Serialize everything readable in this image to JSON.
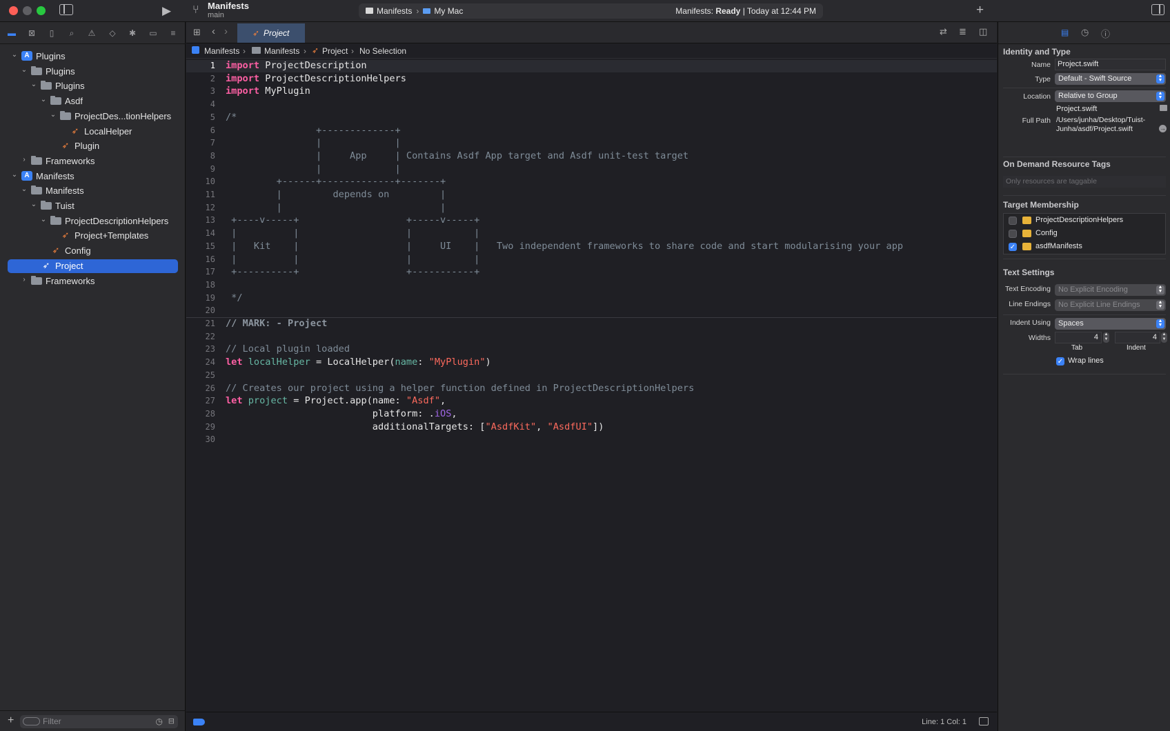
{
  "titlebar": {
    "scheme_name": "Manifests",
    "branch": "main",
    "destination_scheme": "Manifests",
    "destination_device": "My Mac",
    "status_prefix": "Manifests: ",
    "status_state": "Ready",
    "status_time": " | Today at 12:44 PM",
    "icons": [
      "sidebar-toggle-icon",
      "run-icon",
      "branch-icon",
      "add-icon",
      "inspector-toggle-icon"
    ]
  },
  "navigator": {
    "tabs": [
      "folder-icon",
      "source-control-icon",
      "bookmark-icon",
      "find-icon",
      "issue-icon",
      "test-icon",
      "debug-icon",
      "breakpoint-icon",
      "report-icon"
    ],
    "tree": [
      {
        "label": "Plugins",
        "icon": "project",
        "depth": 0,
        "expanded": true
      },
      {
        "label": "Plugins",
        "icon": "folder",
        "depth": 1,
        "expanded": true
      },
      {
        "label": "Plugins",
        "icon": "folder",
        "depth": 2,
        "expanded": true
      },
      {
        "label": "Asdf",
        "icon": "folder",
        "depth": 3,
        "expanded": true
      },
      {
        "label": "ProjectDes...tionHelpers",
        "icon": "folder",
        "depth": 4,
        "expanded": true
      },
      {
        "label": "LocalHelper",
        "icon": "swift",
        "depth": 5
      },
      {
        "label": "Plugin",
        "icon": "swift",
        "depth": 4
      },
      {
        "label": "Frameworks",
        "icon": "folder",
        "depth": 1,
        "expanded": false
      },
      {
        "label": "Manifests",
        "icon": "project",
        "depth": 0,
        "expanded": true
      },
      {
        "label": "Manifests",
        "icon": "folder",
        "depth": 1,
        "expanded": true
      },
      {
        "label": "Tuist",
        "icon": "folder",
        "depth": 2,
        "expanded": true
      },
      {
        "label": "ProjectDescriptionHelpers",
        "icon": "folder",
        "depth": 3,
        "expanded": true
      },
      {
        "label": "Project+Templates",
        "icon": "swift",
        "depth": 4
      },
      {
        "label": "Config",
        "icon": "swift",
        "depth": 3
      },
      {
        "label": "Project",
        "icon": "swift",
        "depth": 2,
        "selected": true
      },
      {
        "label": "Frameworks",
        "icon": "folder",
        "depth": 1,
        "expanded": false
      }
    ],
    "filter_placeholder": "Filter"
  },
  "editor": {
    "tab_label": "Project",
    "breadcrumb": [
      "Manifests",
      "Manifests",
      "Project",
      "No Selection"
    ],
    "current_line": 1,
    "lines": [
      [
        [
          "kw",
          "import"
        ],
        [
          "plain",
          " ProjectDescription"
        ]
      ],
      [
        [
          "kw",
          "import"
        ],
        [
          "plain",
          " ProjectDescriptionHelpers"
        ]
      ],
      [
        [
          "kw",
          "import"
        ],
        [
          "plain",
          " MyPlugin"
        ]
      ],
      [],
      [
        [
          "cm",
          "/*"
        ]
      ],
      [
        [
          "cm",
          "                +-------------+"
        ]
      ],
      [
        [
          "cm",
          "                |             |"
        ]
      ],
      [
        [
          "cm",
          "                |     App     | Contains Asdf App target and Asdf unit-test target"
        ]
      ],
      [
        [
          "cm",
          "                |             |"
        ]
      ],
      [
        [
          "cm",
          "         +------+-------------+-------+"
        ]
      ],
      [
        [
          "cm",
          "         |         depends on         |"
        ]
      ],
      [
        [
          "cm",
          "         |                            |"
        ]
      ],
      [
        [
          "cm",
          " +----v-----+                   +-----v-----+"
        ]
      ],
      [
        [
          "cm",
          " |          |                   |           |"
        ]
      ],
      [
        [
          "cm",
          " |   Kit    |                   |     UI    |   Two independent frameworks to share code and start modularising your app"
        ]
      ],
      [
        [
          "cm",
          " |          |                   |           |"
        ]
      ],
      [
        [
          "cm",
          " +----------+                   +-----------+"
        ]
      ],
      [],
      [
        [
          "cm",
          " */"
        ]
      ],
      [],
      [
        [
          "mark",
          "// MARK: - Project"
        ]
      ],
      [],
      [
        [
          "cm",
          "// Local plugin loaded"
        ]
      ],
      [
        [
          "kw",
          "let"
        ],
        [
          "plain",
          " "
        ],
        [
          "var",
          "localHelper"
        ],
        [
          "plain",
          " = LocalHelper("
        ],
        [
          "var",
          "name"
        ],
        [
          "plain",
          ": "
        ],
        [
          "str",
          "\"MyPlugin\""
        ],
        [
          "plain",
          ")"
        ]
      ],
      [],
      [
        [
          "cm",
          "// Creates our project using a helper function defined in ProjectDescriptionHelpers"
        ]
      ],
      [
        [
          "kw",
          "let"
        ],
        [
          "plain",
          " "
        ],
        [
          "var",
          "project"
        ],
        [
          "plain",
          " = Project.app(name: "
        ],
        [
          "str",
          "\"Asdf\""
        ],
        [
          "plain",
          ","
        ]
      ],
      [
        [
          "plain",
          "                          platform: ."
        ],
        [
          "fn",
          "iOS"
        ],
        [
          "plain",
          ","
        ]
      ],
      [
        [
          "plain",
          "                          additionalTargets: ["
        ],
        [
          "str",
          "\"AsdfKit\""
        ],
        [
          "plain",
          ", "
        ],
        [
          "str",
          "\"AsdfUI\""
        ],
        [
          "plain",
          "])"
        ]
      ],
      []
    ],
    "status_line": "Line: 1  Col: 1"
  },
  "inspector": {
    "tabs": [
      "file-inspector-icon",
      "history-icon",
      "help-icon"
    ],
    "identity_title": "Identity and Type",
    "name_label": "Name",
    "name_value": "Project.swift",
    "type_label": "Type",
    "type_value": "Default - Swift Source",
    "location_label": "Location",
    "location_value": "Relative to Group",
    "location_file": "Project.swift",
    "fullpath_label": "Full Path",
    "fullpath_line1": "/Users/junha/Desktop/Tuist-",
    "fullpath_line2": "Junha/asdf/Project.swift",
    "odr_title": "On Demand Resource Tags",
    "odr_placeholder": "Only resources are taggable",
    "membership_title": "Target Membership",
    "targets": [
      {
        "name": "ProjectDescriptionHelpers",
        "checked": false
      },
      {
        "name": "Config",
        "checked": false
      },
      {
        "name": "asdfManifests",
        "checked": true
      }
    ],
    "text_settings_title": "Text Settings",
    "encoding_label": "Text Encoding",
    "encoding_value": "No Explicit Encoding",
    "line_endings_label": "Line Endings",
    "line_endings_value": "No Explicit Line Endings",
    "indent_label": "Indent Using",
    "indent_value": "Spaces",
    "widths_label": "Widths",
    "tab_width": "4",
    "indent_width": "4",
    "tab_caption": "Tab",
    "indent_caption": "Indent",
    "wrap_label": "Wrap lines",
    "wrap_checked": true
  },
  "colors": {
    "accent": "#3b82f6",
    "selection": "#2e66d6",
    "keyword": "#fc5fa3",
    "string": "#fc6a5d",
    "comment": "#7f8c98",
    "swift_file": "#f0813e"
  }
}
